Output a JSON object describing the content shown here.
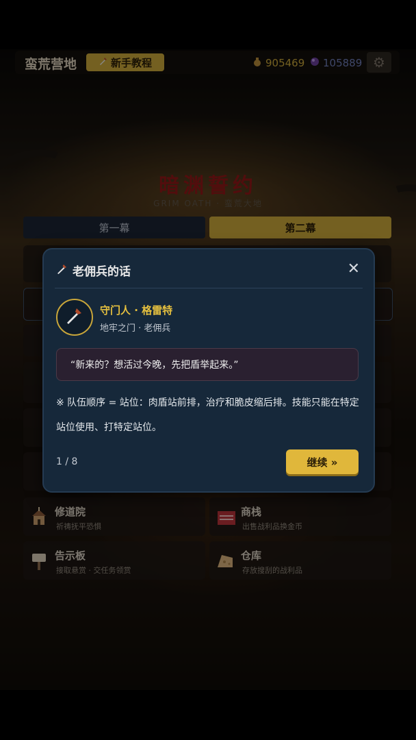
{
  "topbar": {
    "camp_title": "蛮荒营地",
    "tutorial_label": "新手教程",
    "gold": "905469",
    "gems": "105889"
  },
  "game": {
    "title": "暗渊誓约",
    "subtitle": "GRIM OATH · 蛮荒大地"
  },
  "acts": [
    {
      "label": "第一幕"
    },
    {
      "label": "第二幕"
    }
  ],
  "menu": {
    "abbey": {
      "name": "修道院",
      "desc": "祈祷抚平恐惧"
    },
    "market": {
      "name": "商栈",
      "desc": "出售战利品换金币"
    },
    "board": {
      "name": "告示板",
      "desc": "接取悬赏 · 交任务领赏"
    },
    "storage": {
      "name": "仓库",
      "desc": "存放搜刮的战利品"
    }
  },
  "dialog": {
    "title": "老佣兵的话",
    "speaker": "守门人 · 格雷特",
    "speaker_sub": "地牢之门 · 老佣兵",
    "quote": "“新来的？想活过今晚，先把盾举起来。”",
    "tip": "※ 队伍顺序 = 站位：肉盾站前排，治疗和脆皮缩后排。技能只能在特定站位使用、打特定站位。",
    "page": "1 / 8",
    "continue_label": "继续 »"
  },
  "colors": {
    "accent_gold": "#e0b73b",
    "title_red": "#8e1818",
    "dialog_bg": "#16283a",
    "gold_text": "#c9a63a",
    "gem_text": "#6d7bb6"
  },
  "icons": {
    "gold": "money-bag-icon",
    "gem": "orb-icon",
    "settings": "gear-icon",
    "dialog": "dagger-icon",
    "close": "close-icon"
  }
}
